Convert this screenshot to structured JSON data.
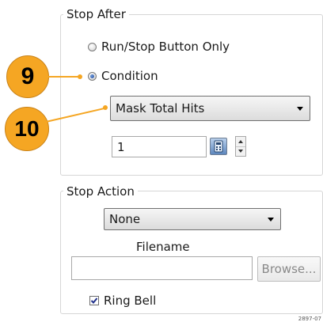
{
  "stop_after": {
    "title": "Stop After",
    "options": [
      "Run/Stop Button Only",
      "Condition"
    ],
    "selected_option": "Condition",
    "condition_value": "Mask Total Hits",
    "count_value": "1"
  },
  "stop_action": {
    "title": "Stop Action",
    "action_value": "None",
    "filename_label": "Filename",
    "filename_value": "",
    "browse_label": "Browse...",
    "ring_bell_label": "Ring Bell",
    "ring_bell_checked": true
  },
  "callouts": [
    "9",
    "10"
  ],
  "figure_id": "2897-07",
  "icons": {
    "calculator": "calculator-icon",
    "spin_up": "spin-up-icon",
    "spin_down": "spin-down-icon",
    "dropdown_arrow": "chevron-down-icon",
    "check": "checkmark-icon"
  },
  "colors": {
    "callout": "#f5a623",
    "border": "#d6d6d6",
    "disabled_text": "#8a8a8a"
  }
}
